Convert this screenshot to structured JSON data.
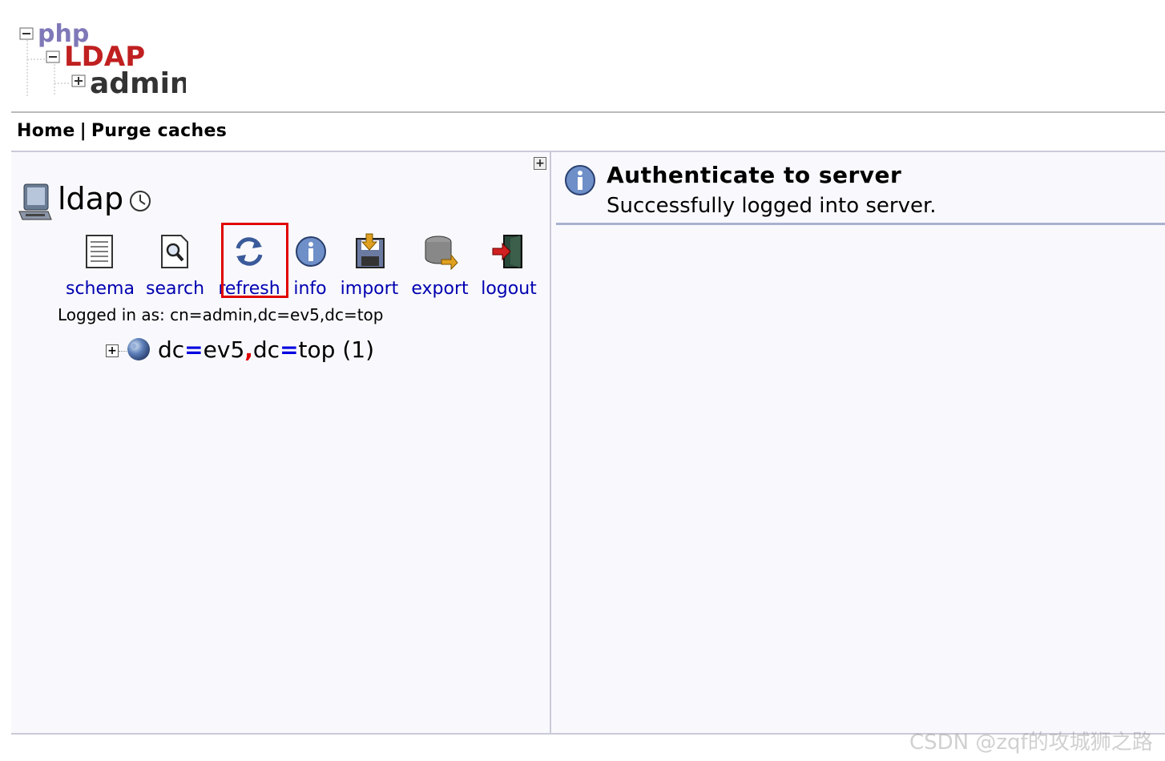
{
  "logo": {
    "line1": "php",
    "line2": "LDAP",
    "line3": "admin"
  },
  "nav": {
    "home": "Home",
    "separator": "|",
    "purge": "Purge caches"
  },
  "server": {
    "name": "ldap"
  },
  "actions": [
    {
      "label": "schema",
      "icon": "schema-icon"
    },
    {
      "label": "search",
      "icon": "search-icon"
    },
    {
      "label": "refresh",
      "icon": "refresh-icon"
    },
    {
      "label": "info",
      "icon": "info-icon"
    },
    {
      "label": "import",
      "icon": "import-icon"
    },
    {
      "label": "export",
      "icon": "export-icon"
    },
    {
      "label": "logout",
      "icon": "logout-icon"
    }
  ],
  "logged_in": "Logged in as: cn=admin,dc=ev5,dc=top",
  "tree": {
    "toggle": "+",
    "parts": {
      "a": "dc",
      "eq1": "=",
      "b": "ev5",
      "comma": ",",
      "c": "dc",
      "eq2": "=",
      "d": "top",
      "count": "(1)"
    }
  },
  "message": {
    "title": "Authenticate to server",
    "body": "Successfully logged into server."
  },
  "watermark": "CSDN @zqf的攻城狮之路",
  "colors": {
    "link": "#0000b0",
    "highlight": "#e00000",
    "panel": "#f9f9fd"
  }
}
